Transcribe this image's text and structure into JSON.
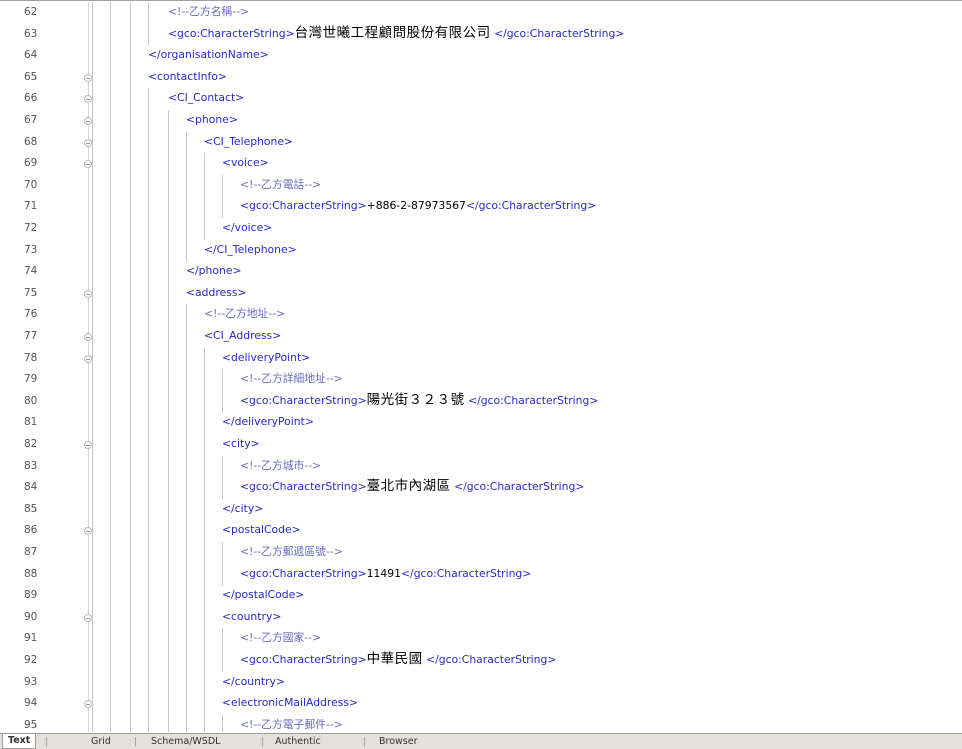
{
  "editor": {
    "lines": [
      {
        "n": "62",
        "depth": 4,
        "tokens": [
          {
            "t": "<!--乙方名稱-->",
            "c": "cmt"
          }
        ],
        "fold": false
      },
      {
        "n": "63",
        "depth": 4,
        "tokens": [
          {
            "t": "<gco:CharacterString>",
            "c": "tag"
          },
          {
            "t": "台灣世曦工程顧問股份有限公司",
            "c": "txt"
          },
          {
            "t": " </gco:CharacterString>",
            "c": "tag"
          }
        ],
        "fold": false
      },
      {
        "n": "64",
        "depth": 3,
        "tokens": [
          {
            "t": "</organisationName>",
            "c": "tag"
          }
        ],
        "fold": false
      },
      {
        "n": "65",
        "depth": 3,
        "tokens": [
          {
            "t": "<contactInfo>",
            "c": "tag"
          }
        ],
        "fold": true
      },
      {
        "n": "66",
        "depth": 4,
        "tokens": [
          {
            "t": "<CI_Contact>",
            "c": "tag"
          }
        ],
        "fold": true
      },
      {
        "n": "67",
        "depth": 5,
        "tokens": [
          {
            "t": "<phone>",
            "c": "tag"
          }
        ],
        "fold": true
      },
      {
        "n": "68",
        "depth": 6,
        "tokens": [
          {
            "t": "<CI_Telephone>",
            "c": "tag"
          }
        ],
        "fold": true
      },
      {
        "n": "69",
        "depth": 7,
        "tokens": [
          {
            "t": "<voice>",
            "c": "tag"
          }
        ],
        "fold": true
      },
      {
        "n": "70",
        "depth": 8,
        "tokens": [
          {
            "t": "<!--乙方電話-->",
            "c": "cmt"
          }
        ],
        "fold": false
      },
      {
        "n": "71",
        "depth": 8,
        "tokens": [
          {
            "t": "<gco:CharacterString>",
            "c": "tag"
          },
          {
            "t": "+886-2-87973567",
            "c": "txt",
            "small": true
          },
          {
            "t": "</gco:CharacterString>",
            "c": "tag"
          }
        ],
        "fold": false
      },
      {
        "n": "72",
        "depth": 7,
        "tokens": [
          {
            "t": "</voice>",
            "c": "tag"
          }
        ],
        "fold": false
      },
      {
        "n": "73",
        "depth": 6,
        "tokens": [
          {
            "t": "</CI_Telephone>",
            "c": "tag"
          }
        ],
        "fold": false
      },
      {
        "n": "74",
        "depth": 5,
        "tokens": [
          {
            "t": "</phone>",
            "c": "tag"
          }
        ],
        "fold": false
      },
      {
        "n": "75",
        "depth": 5,
        "tokens": [
          {
            "t": "<address>",
            "c": "tag"
          }
        ],
        "fold": true
      },
      {
        "n": "76",
        "depth": 6,
        "tokens": [
          {
            "t": "<!--乙方地址-->",
            "c": "cmt"
          }
        ],
        "fold": false
      },
      {
        "n": "77",
        "depth": 6,
        "tokens": [
          {
            "t": "<CI_Address>",
            "c": "tag"
          }
        ],
        "fold": true
      },
      {
        "n": "78",
        "depth": 7,
        "tokens": [
          {
            "t": "<deliveryPoint>",
            "c": "tag"
          }
        ],
        "fold": true
      },
      {
        "n": "79",
        "depth": 8,
        "tokens": [
          {
            "t": "<!--乙方詳細地址-->",
            "c": "cmt"
          }
        ],
        "fold": false
      },
      {
        "n": "80",
        "depth": 8,
        "tokens": [
          {
            "t": "<gco:CharacterString>",
            "c": "tag"
          },
          {
            "t": "陽光街３２３號",
            "c": "txt"
          },
          {
            "t": " </gco:CharacterString>",
            "c": "tag"
          }
        ],
        "fold": false
      },
      {
        "n": "81",
        "depth": 7,
        "tokens": [
          {
            "t": "</deliveryPoint>",
            "c": "tag"
          }
        ],
        "fold": false
      },
      {
        "n": "82",
        "depth": 7,
        "tokens": [
          {
            "t": "<city>",
            "c": "tag"
          }
        ],
        "fold": true
      },
      {
        "n": "83",
        "depth": 8,
        "tokens": [
          {
            "t": "<!--乙方城市-->",
            "c": "cmt"
          }
        ],
        "fold": false
      },
      {
        "n": "84",
        "depth": 8,
        "tokens": [
          {
            "t": "<gco:CharacterString>",
            "c": "tag"
          },
          {
            "t": "臺北市內湖區",
            "c": "txt"
          },
          {
            "t": " </gco:CharacterString>",
            "c": "tag"
          }
        ],
        "fold": false
      },
      {
        "n": "85",
        "depth": 7,
        "tokens": [
          {
            "t": "</city>",
            "c": "tag"
          }
        ],
        "fold": false
      },
      {
        "n": "86",
        "depth": 7,
        "tokens": [
          {
            "t": "<postalCode>",
            "c": "tag"
          }
        ],
        "fold": true
      },
      {
        "n": "87",
        "depth": 8,
        "tokens": [
          {
            "t": "<!--乙方郵遞區號-->",
            "c": "cmt"
          }
        ],
        "fold": false
      },
      {
        "n": "88",
        "depth": 8,
        "tokens": [
          {
            "t": "<gco:CharacterString>",
            "c": "tag"
          },
          {
            "t": "11491",
            "c": "txt",
            "small": true
          },
          {
            "t": "</gco:CharacterString>",
            "c": "tag"
          }
        ],
        "fold": false
      },
      {
        "n": "89",
        "depth": 7,
        "tokens": [
          {
            "t": "</postalCode>",
            "c": "tag"
          }
        ],
        "fold": false
      },
      {
        "n": "90",
        "depth": 7,
        "tokens": [
          {
            "t": "<country>",
            "c": "tag"
          }
        ],
        "fold": true
      },
      {
        "n": "91",
        "depth": 8,
        "tokens": [
          {
            "t": "<!--乙方國家-->",
            "c": "cmt"
          }
        ],
        "fold": false
      },
      {
        "n": "92",
        "depth": 8,
        "tokens": [
          {
            "t": "<gco:CharacterString>",
            "c": "tag"
          },
          {
            "t": "中華民國",
            "c": "txt"
          },
          {
            "t": " </gco:CharacterString>",
            "c": "tag"
          }
        ],
        "fold": false
      },
      {
        "n": "93",
        "depth": 7,
        "tokens": [
          {
            "t": "</country>",
            "c": "tag"
          }
        ],
        "fold": false
      },
      {
        "n": "94",
        "depth": 7,
        "tokens": [
          {
            "t": "<electronicMailAddress>",
            "c": "tag"
          }
        ],
        "fold": true
      },
      {
        "n": "95",
        "depth": 8,
        "tokens": [
          {
            "t": "<!--乙方電子郵件-->",
            "c": "cmt"
          }
        ],
        "fold": false
      }
    ]
  },
  "tabs": [
    {
      "label": "Text",
      "active": true
    },
    {
      "label": "Grid",
      "active": false
    },
    {
      "label": "Schema/WSDL",
      "active": false
    },
    {
      "label": "Authentic",
      "active": false
    },
    {
      "label": "Browser",
      "active": false
    }
  ],
  "colors": {
    "tag": "#2929c8",
    "comment": "#6b6bbf",
    "text": "#000000",
    "guide": "#c8c8c8"
  }
}
